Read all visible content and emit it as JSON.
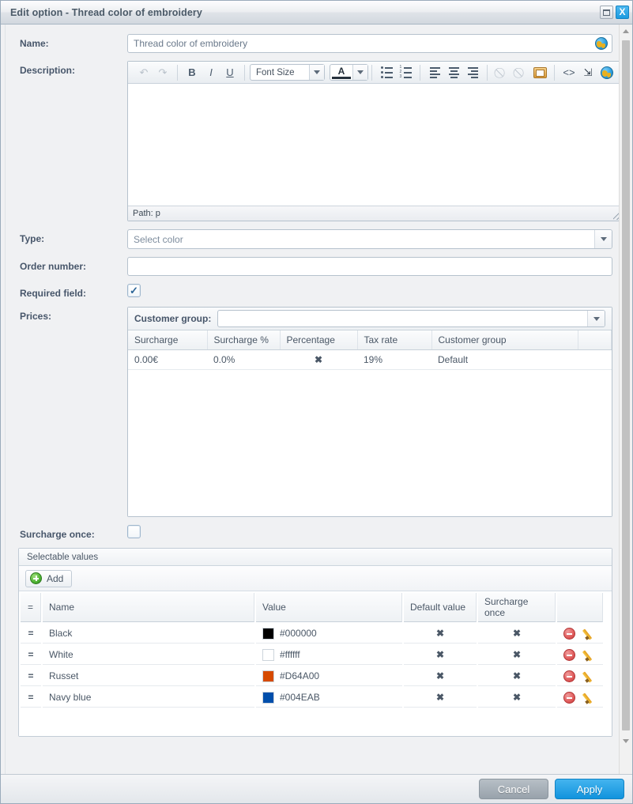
{
  "window": {
    "title": "Edit option - Thread color of embroidery",
    "restore_label": "Restore",
    "close_label": "X"
  },
  "form": {
    "name_label": "Name:",
    "name_value": "Thread color of embroidery",
    "name_placeholder": "Thread color of embroidery",
    "description_label": "Description:",
    "type_label": "Type:",
    "type_value": "Select color",
    "order_number_label": "Order number:",
    "order_number_value": "",
    "required_field_label": "Required field:",
    "required_field_checked": "✓",
    "prices_label": "Prices:",
    "surcharge_once_label": "Surcharge once:"
  },
  "editor": {
    "font_size_label": "Font Size",
    "path_text": "Path: p",
    "content": "",
    "buttons": {
      "undo": "↶",
      "redo": "↷",
      "bold": "B",
      "italic": "I",
      "underline": "U",
      "text_color": "A",
      "link": "⊘",
      "unlink": "⊘",
      "image": "image",
      "source_code": "<>",
      "fullscreen": "⤡",
      "translate": "globe"
    }
  },
  "prices": {
    "customer_group_label": "Customer group:",
    "customer_group_value": "",
    "columns": [
      "Surcharge",
      "Surcharge %",
      "Percentage",
      "Tax rate",
      "Customer group",
      ""
    ],
    "rows": [
      {
        "surcharge": "0.00€",
        "surcharge_pct": "0.0%",
        "percentage": "✖",
        "tax_rate": "19%",
        "customer_group": "Default",
        "actions": ""
      }
    ]
  },
  "selectable_values": {
    "panel_title": "Selectable values",
    "add_label": "Add",
    "columns": [
      "=",
      "Name",
      "Value",
      "Default value",
      "Surcharge once",
      ""
    ],
    "rows": [
      {
        "handle": "=",
        "name": "Black",
        "color": "#000000",
        "value": "#000000",
        "default_value": "✖",
        "surcharge_once": "✖"
      },
      {
        "handle": "=",
        "name": "White",
        "color": "#ffffff",
        "value": "#ffffff",
        "default_value": "✖",
        "surcharge_once": "✖"
      },
      {
        "handle": "=",
        "name": "Russet",
        "color": "#D64A00",
        "value": "#D64A00",
        "default_value": "✖",
        "surcharge_once": "✖"
      },
      {
        "handle": "=",
        "name": "Navy blue",
        "color": "#004EAB",
        "value": "#004EAB",
        "default_value": "✖",
        "surcharge_once": "✖"
      }
    ]
  },
  "footer": {
    "cancel_label": "Cancel",
    "apply_label": "Apply"
  },
  "colors": {
    "accent": "#1193dd",
    "danger": "#cc2222",
    "title_text": "#4b5a68"
  }
}
